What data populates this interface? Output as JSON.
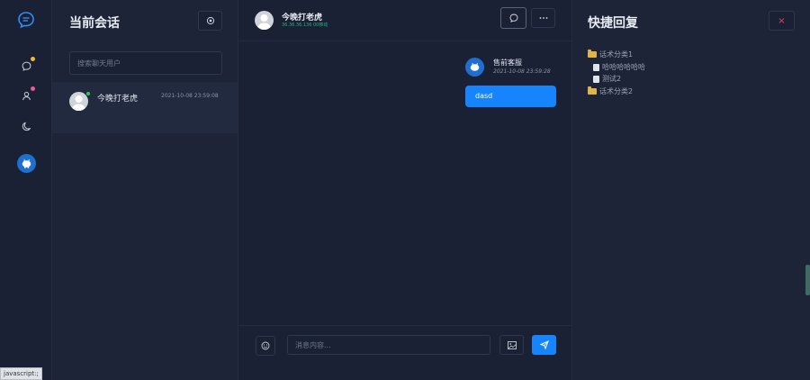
{
  "sessions": {
    "title": "当前会话",
    "search_placeholder": "搜索聊天用户",
    "items": [
      {
        "name": "今晚打老虎",
        "time": "2021-10-08 23:59:08",
        "online": true
      }
    ]
  },
  "chat": {
    "contact_name": "今晚打老虎",
    "contact_sub": "36.36.36.136 00移动",
    "messages": [
      {
        "sender": "售前客服",
        "time": "2021-10-08 23:59:28",
        "text": "dasd"
      }
    ],
    "input_placeholder": "消息内容..."
  },
  "quick_reply": {
    "title": "快捷回复",
    "close_label": "×",
    "tree": [
      {
        "label": "话术分类1",
        "type": "folder",
        "open": true,
        "children": [
          {
            "label": "哈哈哈哈哈哈",
            "type": "file"
          },
          {
            "label": "测试2",
            "type": "file"
          }
        ]
      },
      {
        "label": "话术分类2",
        "type": "folder",
        "open": false
      }
    ]
  },
  "status_bar": {
    "text": "javascript:;"
  },
  "colors": {
    "accent": "#1684fc",
    "online": "#34c85a",
    "danger": "#e0445a",
    "badge_yellow": "#f5b82e",
    "badge_pink": "#f05a8c"
  },
  "icons": [
    "chat-logo-icon",
    "chat-icon",
    "user-icon",
    "moon-icon",
    "piggy-icon",
    "settings-icon",
    "message-icon",
    "more-icon",
    "emoji-icon",
    "image-icon",
    "send-icon"
  ]
}
